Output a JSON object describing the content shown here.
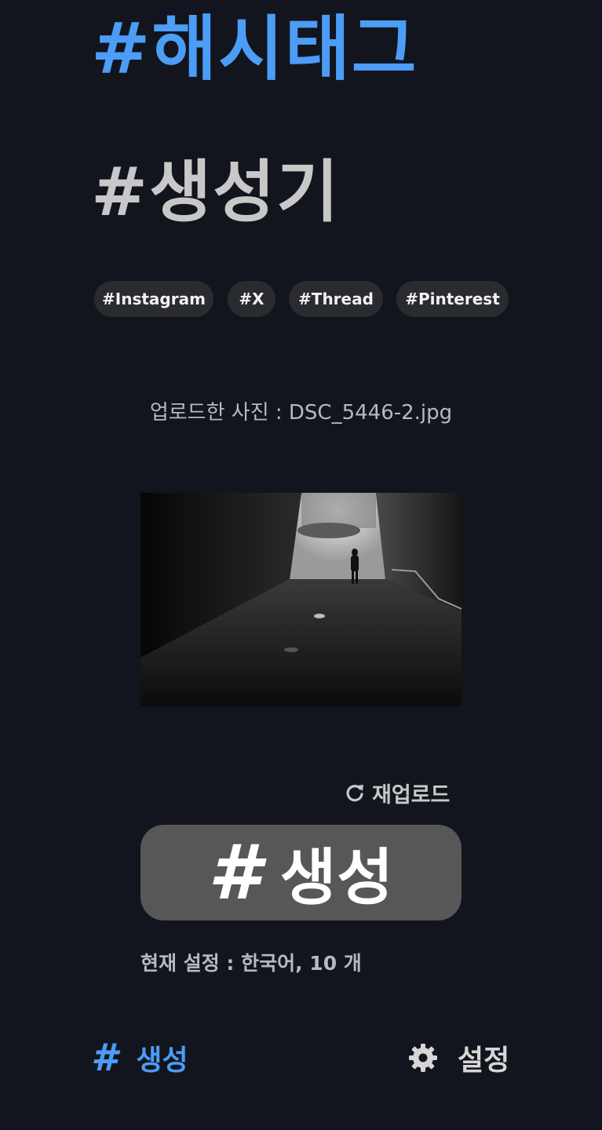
{
  "header": {
    "title_line1": "#해시태그",
    "title_line2": "#생성기"
  },
  "platforms": [
    {
      "label": "#Instagram"
    },
    {
      "label": "#X"
    },
    {
      "label": "#Thread"
    },
    {
      "label": "#Pinterest"
    }
  ],
  "upload": {
    "label": "업로드한 사진 : DSC_5446-2.jpg",
    "reupload_label": "재업로드",
    "reupload_icon": "reload-icon"
  },
  "generate": {
    "hash_symbol": "#",
    "label": "생성"
  },
  "settings_summary": "현재 설정 : 한국어, 10 개",
  "bottom_nav": {
    "generate": {
      "icon": "hash",
      "label": "생성",
      "active": true
    },
    "settings": {
      "icon": "gear-icon",
      "label": "설정",
      "active": false
    }
  },
  "colors": {
    "background": "#12151d",
    "accent": "#4b9df5",
    "chip_bg": "#2a2b2f",
    "button_bg": "#575757"
  }
}
